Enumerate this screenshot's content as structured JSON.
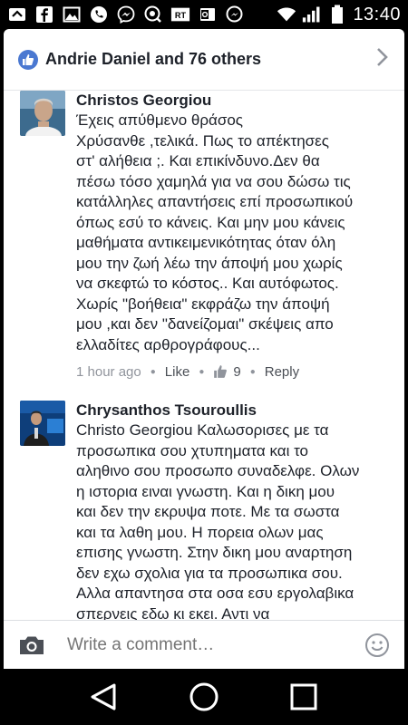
{
  "status_bar": {
    "time": "13:40",
    "left_icons": [
      "collapse-chevron-icon",
      "facebook-icon",
      "image-icon",
      "phone-icon",
      "messenger-icon",
      "messenger-icon",
      "rt-news-icon",
      "outlook-icon",
      "messenger-icon"
    ],
    "right_icons": [
      "wifi-icon",
      "signal-icon",
      "battery-icon"
    ]
  },
  "likes_header": {
    "text": "Andrie Daniel and 76 others"
  },
  "comments": [
    {
      "author": "Christos Georgiou",
      "text": "Έχεις απύθμενο θράσος\nΧρύσανθε ,τελικά. Πως το απέκτησες\nστ' αλήθεια ;. Και επικίνδυνο.Δεν θα\nπέσω τόσο χαμηλά για να σου δώσω τις\nκατάλληλες απαντήσεις επί προσωπικού\nόπως εσύ το κάνεις. Και  μην μου κάνεις\nμαθήματα αντικειμενικότητας όταν όλη\nμου την ζωή λέω την άποψή μου χωρίς\nνα σκεφτώ το κόστος.. Και αυτόφωτος.\nΧωρίς \"βοήθεια\"  εκφράζω την άποψή\nμου ,και  δεν  \"δανείζομαι\"  σκέψεις απο\nελλαδίτες αρθρογράφους...",
      "time": "1 hour ago",
      "like_label": "Like",
      "like_count": "9",
      "reply_label": "Reply"
    },
    {
      "author": "Chrysanthos Tsouroullis",
      "text": "Christo Georgiou Καλωσορισες με τα\nπροσωπικα σου χτυπηματα και το\nαληθινο σου προσωπο συναδελφε. Ολων\nη ιστορια ειναι γνωστη. Και η δικη μου\nκαι δεν την εκρυψα ποτε. Με τα σωστα\nκαι τα λαθη μου. Η πορεια ολων μας\nεπισης γνωστη. Στην δικη μου αναρτηση\nδεν εχω σχολια για τα προσωπικα σου.\nΑλλα απαντησα στα οσα εσυ εργολαβικα\nσπερνεις εδω κι εκει. Αντι να\nαπολογηθεις με τα που εκανε του και να"
    }
  ],
  "composer": {
    "placeholder": "Write a comment…"
  },
  "navbar": {
    "icons": [
      "back-triangle-icon",
      "home-circle-icon",
      "recents-square-icon"
    ]
  }
}
